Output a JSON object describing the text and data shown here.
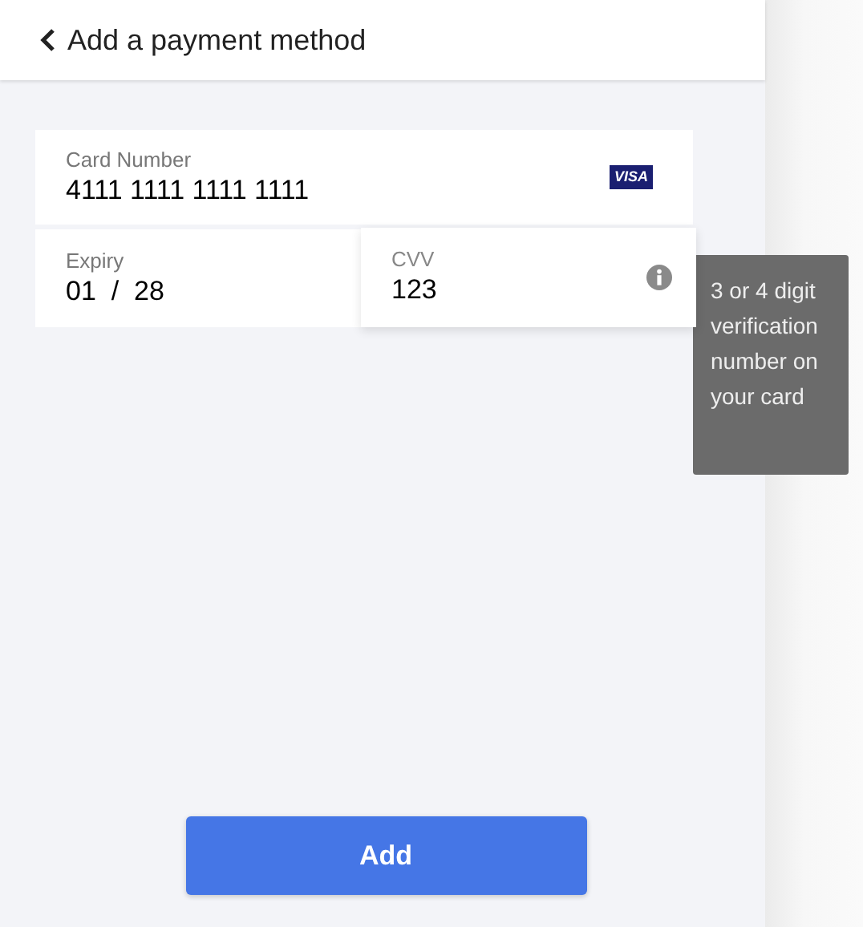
{
  "header": {
    "title": "Add a payment method"
  },
  "card_number": {
    "label": "Card Number",
    "value": "4111 1111 1111 1111",
    "brand": "VISA"
  },
  "expiry": {
    "label": "Expiry",
    "month": "01",
    "separator": "/",
    "year": "28"
  },
  "cvv": {
    "label": "CVV",
    "value": "123",
    "focused": true
  },
  "tooltip": {
    "text": "3 or 4 digit verification number on your card"
  },
  "button": {
    "label": "Add"
  }
}
